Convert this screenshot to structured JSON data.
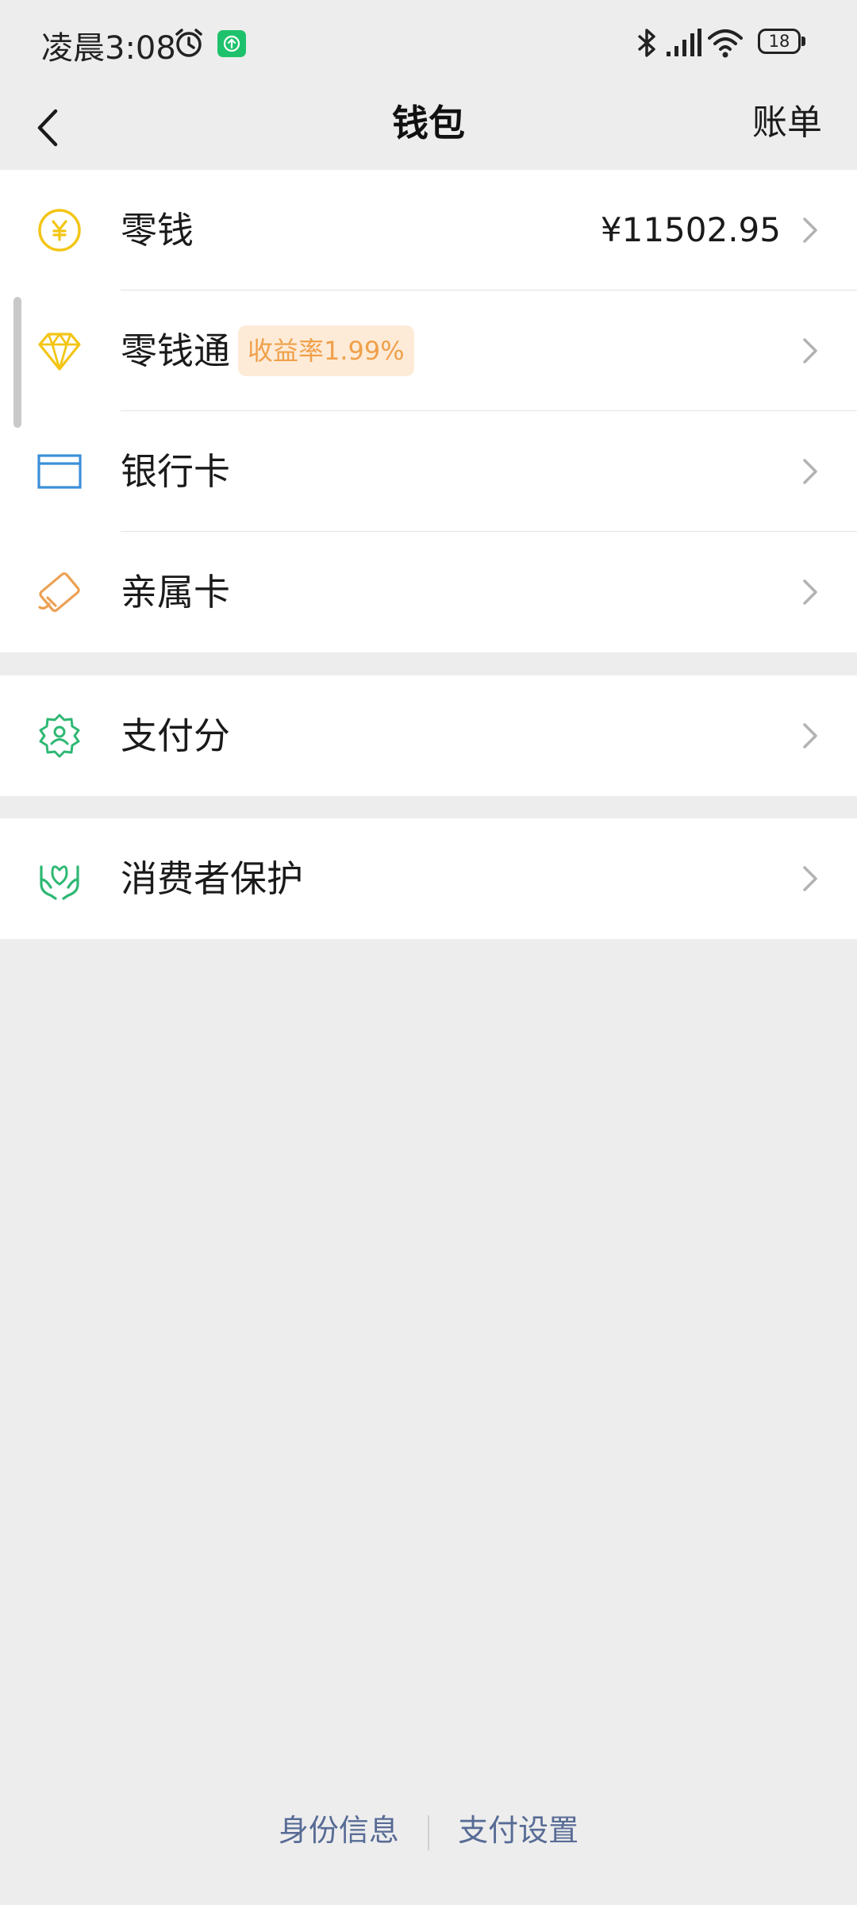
{
  "status_bar": {
    "time": "凌晨3:08",
    "battery": "18"
  },
  "nav": {
    "title": "钱包",
    "right_action": "账单"
  },
  "groups": [
    {
      "items": [
        {
          "label": "零钱",
          "icon": "yuan-coin-icon",
          "value": "¥11502.95"
        },
        {
          "label": "零钱通",
          "icon": "diamond-icon",
          "badge": "收益率1.99%"
        },
        {
          "label": "银行卡",
          "icon": "bank-card-icon"
        },
        {
          "label": "亲属卡",
          "icon": "family-card-icon"
        }
      ]
    },
    {
      "items": [
        {
          "label": "支付分",
          "icon": "pay-score-icon"
        }
      ]
    },
    {
      "items": [
        {
          "label": "消费者保护",
          "icon": "consumer-protection-icon"
        }
      ]
    }
  ],
  "footer": {
    "identity": "身份信息",
    "pay_settings": "支付设置"
  },
  "colors": {
    "background": "#ededed",
    "link": "#576b95",
    "badge_text": "#f0a04a",
    "badge_bg": "#fdebd8",
    "coin_yellow": "#f3c514",
    "bank_blue": "#3b8fd8",
    "family_orange": "#eba154",
    "green": "#2eb873"
  }
}
